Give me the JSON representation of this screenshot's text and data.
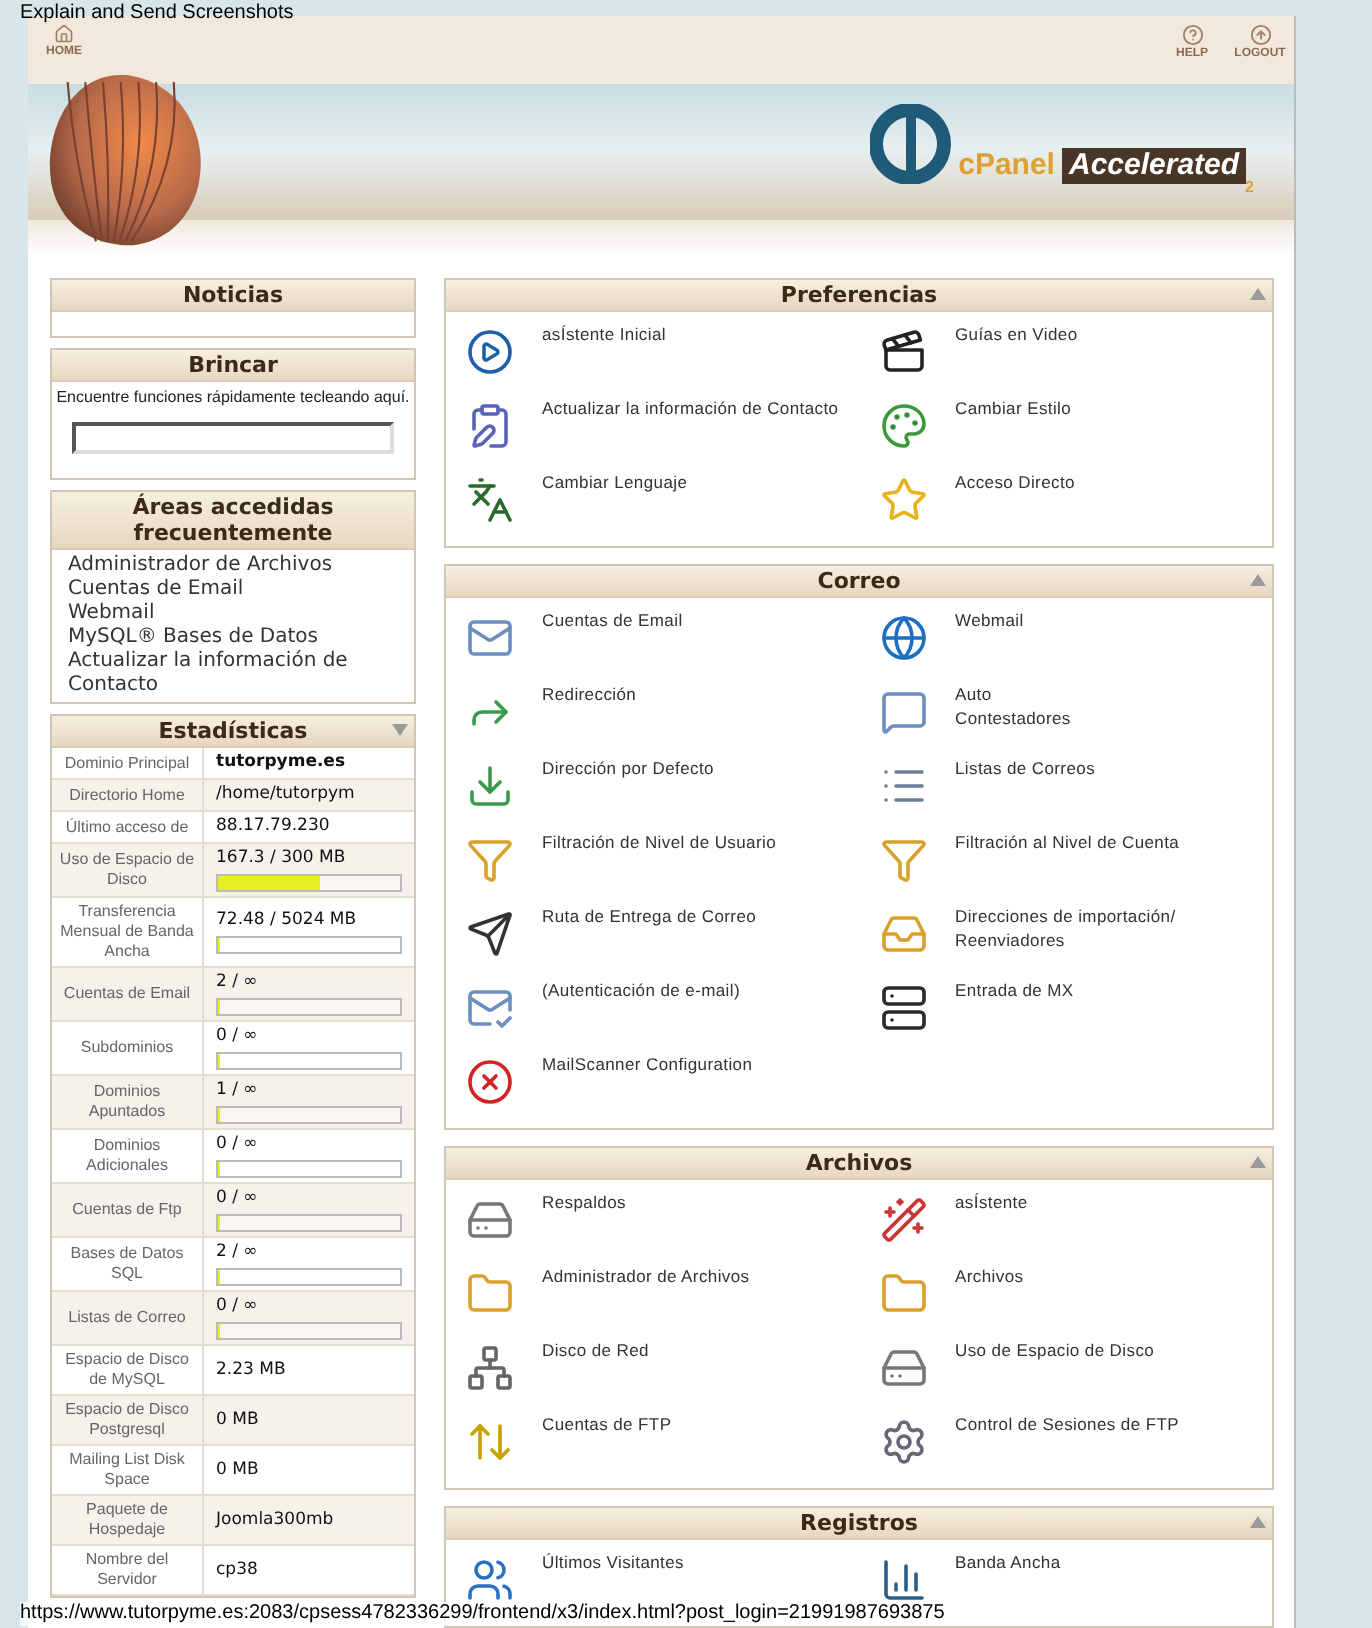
{
  "overlay_title": "Explain and Send Screenshots",
  "header": {
    "nav_left": [
      {
        "label": "HOME"
      }
    ],
    "nav_right": [
      {
        "label": "HELP"
      },
      {
        "label": "LOGOUT"
      }
    ],
    "logo": {
      "brand": "cPanel",
      "suffix": "Accelerated",
      "edition": "2"
    }
  },
  "sidebar": {
    "news": {
      "title": "Noticias"
    },
    "jump": {
      "title": "Brincar",
      "hint": "Encuentre funciones rápidamente tecleando aquí."
    },
    "frequent": {
      "title": "Áreas accedidas frecuentemente",
      "links": [
        "Administrador de Archivos",
        "Cuentas de Email",
        "Webmail",
        "MySQL® Bases de Datos",
        "Actualizar la información de Contacto"
      ]
    },
    "stats": {
      "title": "Estadísticas",
      "rows": [
        {
          "label": "Dominio Principal",
          "value": "tutorpyme.es",
          "bold": true
        },
        {
          "label": "Directorio Home",
          "value": "/home/tutorpym",
          "bold": false
        },
        {
          "label": "Último acceso de",
          "value": "88.17.79.230",
          "bold": false
        },
        {
          "label": "Uso de Espacio de Disco",
          "value": "167.3 / 300 MB",
          "bold": false,
          "level": 0.56
        },
        {
          "label": "Transferencia Mensual de Banda Ancha",
          "value": "72.48 / 5024 MB",
          "bold": false,
          "level": 0
        },
        {
          "label": "Cuentas de Email",
          "value": "2 / ∞",
          "bold": false,
          "level": 0
        },
        {
          "label": "Subdominios",
          "value": "0 / ∞",
          "bold": false,
          "level": 0
        },
        {
          "label": "Dominios Apuntados",
          "value": "1 / ∞",
          "bold": false,
          "level": 0
        },
        {
          "label": "Dominios Adicionales",
          "value": "0 / ∞",
          "bold": false,
          "level": 0
        },
        {
          "label": "Cuentas de Ftp",
          "value": "0 / ∞",
          "bold": false,
          "level": 0
        },
        {
          "label": "Bases de Datos SQL",
          "value": "2 / ∞",
          "bold": false,
          "level": 0
        },
        {
          "label": "Listas de Correo",
          "value": "0 / ∞",
          "bold": false,
          "level": 0
        },
        {
          "label": "Espacio de Disco de MySQL",
          "value": "2.23 MB",
          "bold": false
        },
        {
          "label": "Espacio de Disco Postgresql",
          "value": "0 MB",
          "bold": false
        },
        {
          "label": "Mailing List Disk Space",
          "value": "0 MB",
          "bold": false
        },
        {
          "label": "Paquete de Hospedaje",
          "value": "Joomla300mb",
          "bold": false
        },
        {
          "label": "Nombre del Servidor",
          "value": "cp38",
          "bold": false
        }
      ]
    }
  },
  "sections": [
    {
      "title": "Preferencias",
      "items": [
        {
          "label": "asÍstente Inicial"
        },
        {
          "label": "Guías en Video"
        },
        {
          "label": "Actualizar la información de Contacto"
        },
        {
          "label": "Cambiar Estilo"
        },
        {
          "label": "Cambiar Lenguaje"
        },
        {
          "label": "Acceso Directo"
        }
      ]
    },
    {
      "title": "Correo",
      "items": [
        {
          "label": "Cuentas de Email"
        },
        {
          "label": "Webmail"
        },
        {
          "label": "Redirección"
        },
        {
          "label": "Auto\nContestadores"
        },
        {
          "label": "Dirección por Defecto"
        },
        {
          "label": "Listas de Correos"
        },
        {
          "label": "Filtración de Nivel de Usuario"
        },
        {
          "label": "Filtración al Nivel de Cuenta"
        },
        {
          "label": "Ruta de Entrega de Correo"
        },
        {
          "label": "Direcciones de importación/\nReenviadores"
        },
        {
          "label": "(Autenticación de e-mail)"
        },
        {
          "label": "Entrada de MX"
        },
        {
          "label": "MailScanner Configuration"
        }
      ]
    },
    {
      "title": "Archivos",
      "items": [
        {
          "label": "Respaldos"
        },
        {
          "label": "asÍstente"
        },
        {
          "label": "Administrador de Archivos"
        },
        {
          "label": "Archivos"
        },
        {
          "label": "Disco de Red"
        },
        {
          "label": "Uso de Espacio de Disco"
        },
        {
          "label": "Cuentas de FTP"
        },
        {
          "label": "Control de Sesiones de FTP"
        }
      ]
    },
    {
      "title": "Registros",
      "items": [
        {
          "label": "Últimos Visitantes"
        },
        {
          "label": "Banda Ancha"
        }
      ]
    }
  ],
  "status_url": "https://www.tutorpyme.es:2083/cpsess4782336299/frontend/x3/index.html?post_login=21991987693875"
}
